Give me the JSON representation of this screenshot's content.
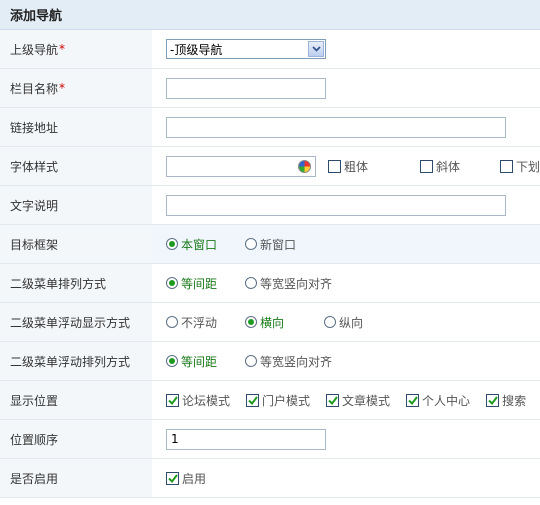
{
  "header": {
    "title": "添加导航"
  },
  "parent_nav": {
    "label": "上级导航",
    "value": "-顶级导航"
  },
  "column_name": {
    "label": "栏目名称",
    "value": ""
  },
  "link_url": {
    "label": "链接地址",
    "value": ""
  },
  "font_style": {
    "label": "字体样式",
    "value": "",
    "options": [
      {
        "label": "粗体",
        "checked": false
      },
      {
        "label": "斜体",
        "checked": false
      },
      {
        "label": "下划",
        "checked": false
      }
    ]
  },
  "text_desc": {
    "label": "文字说明",
    "value": ""
  },
  "target_frame": {
    "label": "目标框架",
    "options": [
      {
        "label": "本窗口",
        "checked": true
      },
      {
        "label": "新窗口",
        "checked": false
      }
    ]
  },
  "submenu_layout": {
    "label": "二级菜单排列方式",
    "options": [
      {
        "label": "等间距",
        "checked": true
      },
      {
        "label": "等宽竖向对齐",
        "checked": false
      }
    ]
  },
  "submenu_float_display": {
    "label": "二级菜单浮动显示方式",
    "options": [
      {
        "label": "不浮动",
        "checked": false
      },
      {
        "label": "横向",
        "checked": true
      },
      {
        "label": "纵向",
        "checked": false
      }
    ]
  },
  "submenu_float_layout": {
    "label": "二级菜单浮动排列方式",
    "options": [
      {
        "label": "等间距",
        "checked": true
      },
      {
        "label": "等宽竖向对齐",
        "checked": false
      }
    ]
  },
  "display_position": {
    "label": "显示位置",
    "options": [
      {
        "label": "论坛模式",
        "checked": true
      },
      {
        "label": "门户模式",
        "checked": true
      },
      {
        "label": "文章模式",
        "checked": true
      },
      {
        "label": "个人中心",
        "checked": true
      },
      {
        "label": "搜索",
        "checked": true
      }
    ]
  },
  "position_order": {
    "label": "位置顺序",
    "value": "1"
  },
  "enabled": {
    "label": "是否启用",
    "option_label": "启用",
    "checked": true
  },
  "required_mark": "*",
  "colors": {
    "accent_green": "#1a7a1a",
    "header_bg": "#e3edf6",
    "label_bg": "#f4f7fa"
  }
}
